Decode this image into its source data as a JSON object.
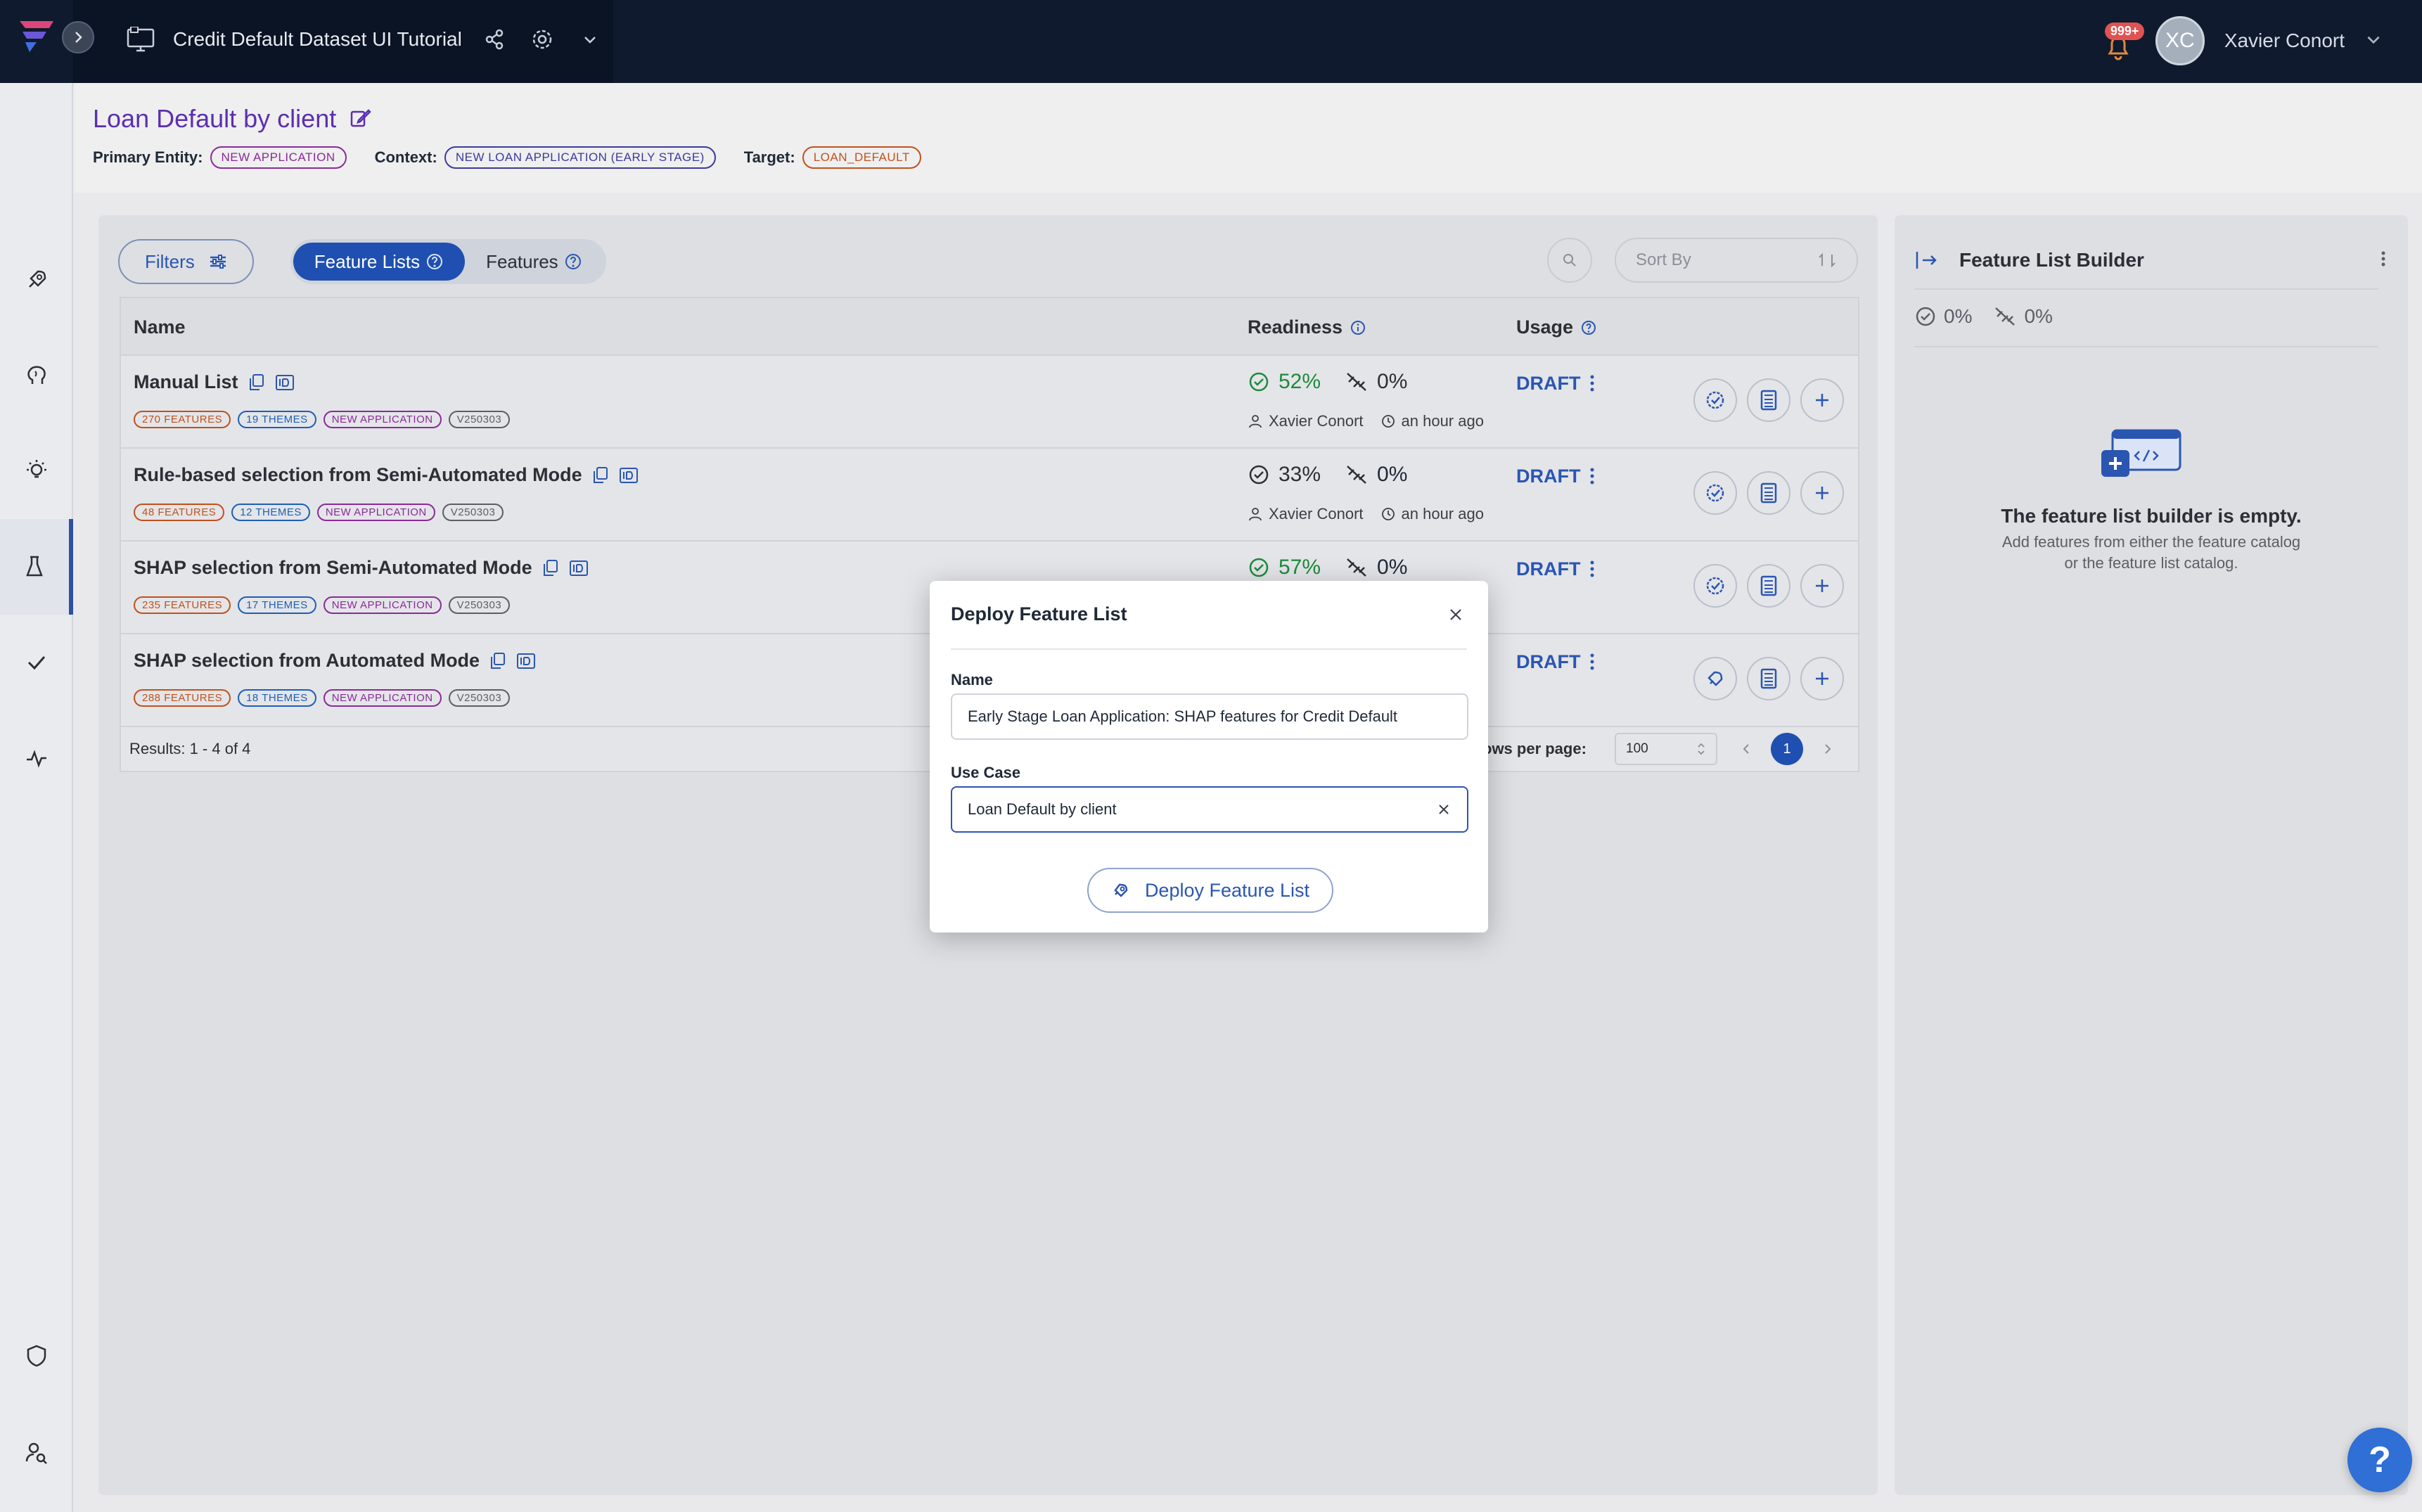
{
  "app": {
    "title": "Credit Default Dataset UI Tutorial",
    "notification_count": "999+",
    "user_initials": "XC",
    "user_name": "Xavier Conort"
  },
  "header": {
    "page_title": "Loan Default by client",
    "primary_entity_label": "Primary Entity:",
    "primary_entity_value": "NEW APPLICATION",
    "context_label": "Context:",
    "context_value": "NEW LOAN APPLICATION (EARLY STAGE)",
    "target_label": "Target:",
    "target_value": "LOAN_DEFAULT"
  },
  "toolbar": {
    "filters_label": "Filters",
    "tabs": [
      {
        "label": "Feature Lists",
        "active": true
      },
      {
        "label": "Features",
        "active": false
      }
    ],
    "sort_placeholder": "Sort By"
  },
  "table": {
    "columns": {
      "name": "Name",
      "readiness": "Readiness",
      "usage": "Usage"
    },
    "rows": [
      {
        "name": "Manual List",
        "features": "270 FEATURES",
        "themes": "19 THEMES",
        "entity": "NEW APPLICATION",
        "version": "V250303",
        "readiness": "52%",
        "online": "0%",
        "author": "Xavier Conort",
        "time": "an hour ago",
        "status": "DRAFT"
      },
      {
        "name": "Rule-based selection from Semi-Automated Mode",
        "features": "48 FEATURES",
        "themes": "12 THEMES",
        "entity": "NEW APPLICATION",
        "version": "V250303",
        "readiness": "33%",
        "online": "0%",
        "author": "Xavier Conort",
        "time": "an hour ago",
        "status": "DRAFT"
      },
      {
        "name": "SHAP selection from Semi-Automated Mode",
        "features": "235 FEATURES",
        "themes": "17 THEMES",
        "entity": "NEW APPLICATION",
        "version": "V250303",
        "readiness": "57%",
        "online": "0%",
        "author": "",
        "time": "",
        "status": "DRAFT"
      },
      {
        "name": "SHAP selection from Automated Mode",
        "features": "288 FEATURES",
        "themes": "18 THEMES",
        "entity": "NEW APPLICATION",
        "version": "V250303",
        "readiness": "",
        "online": "",
        "author": "",
        "time": "",
        "status": "DRAFT"
      }
    ],
    "footer": {
      "results": "Results: 1 - 4 of 4",
      "rows_per_page_label": "ows per page:",
      "rows_per_page_value": "100",
      "current_page": "1"
    }
  },
  "right_panel": {
    "title": "Feature List Builder",
    "readiness_pct": "0%",
    "online_pct": "0%",
    "empty_title": "The feature list builder is empty.",
    "empty_line1": "Add features from either the feature catalog",
    "empty_line2": "or the feature list catalog."
  },
  "modal": {
    "title": "Deploy Feature List",
    "name_label": "Name",
    "name_value": "Early Stage Loan Application: SHAP features for Credit Default",
    "use_case_label": "Use Case",
    "use_case_value": "Loan Default by client",
    "submit_label": "Deploy Feature List"
  },
  "help_label": "?",
  "colors": {
    "topbar": "#0f1a2e",
    "accent": "#1f4fb0",
    "title_purple": "#5b2fb0",
    "ready_green": "#1c8a3c",
    "help_fab": "#2f6fd6"
  }
}
